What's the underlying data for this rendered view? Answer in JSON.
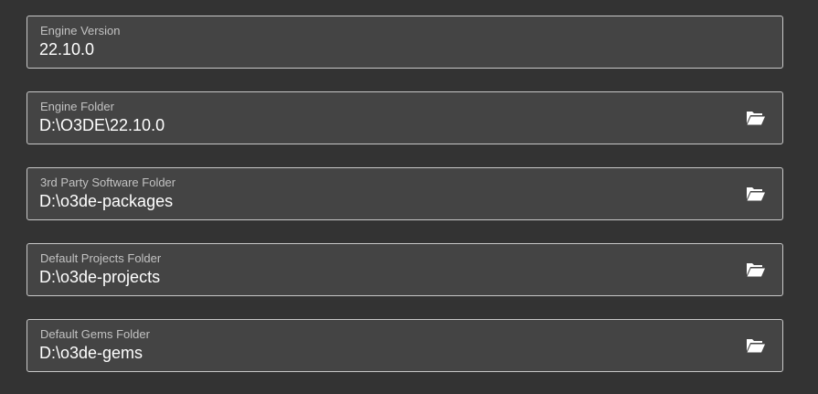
{
  "fields": [
    {
      "label": "Engine Version",
      "value": "22.10.0",
      "has_browse": false
    },
    {
      "label": "Engine Folder",
      "value": "D:\\O3DE\\22.10.0",
      "has_browse": true,
      "browse_icon": "folder-open-icon"
    },
    {
      "label": "3rd Party Software Folder",
      "value": "D:\\o3de-packages",
      "has_browse": true,
      "browse_icon": "folder-open-icon"
    },
    {
      "label": "Default Projects Folder",
      "value": "D:\\o3de-projects",
      "has_browse": true,
      "browse_icon": "folder-open-icon"
    },
    {
      "label": "Default Gems Folder",
      "value": "D:\\o3de-gems",
      "has_browse": true,
      "browse_icon": "folder-open-icon"
    }
  ],
  "colors": {
    "background": "#333333",
    "field_background": "#444444",
    "field_border": "#c8c8c8",
    "label_text": "#c2c2c2",
    "value_text": "#ffffff",
    "icon": "#ffffff"
  }
}
